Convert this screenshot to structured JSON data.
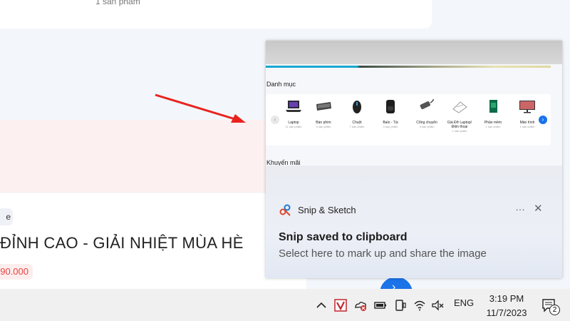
{
  "background_page": {
    "top_card_text": "1 sản phẩm",
    "tag_text": "e",
    "promo_title": "ĐỈNH CAO - GIẢI NHIỆT MÙA HÈ",
    "price": "90.000"
  },
  "snip_preview": {
    "category_heading": "Danh mục",
    "categories": [
      {
        "name": "Laptop",
        "count": "11 sản phẩm",
        "icon": "laptop-icon"
      },
      {
        "name": "Bàn phím",
        "count": "4 sản phẩm",
        "icon": "keyboard-icon"
      },
      {
        "name": "Chuột",
        "count": "7 sản phẩm",
        "icon": "mouse-icon"
      },
      {
        "name": "Balo - Túi",
        "count": "3 sản phẩm",
        "icon": "backpack-icon"
      },
      {
        "name": "Cổng chuyển",
        "count": "3 sản phẩm",
        "icon": "usb-hub-icon"
      },
      {
        "name": "Giá Đỡ Laptop/Điện thoại",
        "count": "1 sản phẩm",
        "icon": "stand-icon"
      },
      {
        "name": "Phần mềm",
        "count": "1 sản phẩm",
        "icon": "software-icon"
      },
      {
        "name": "Màn hình",
        "count": "1 sản phẩm",
        "icon": "monitor-icon"
      }
    ],
    "promo_heading": "Khuyến mãi"
  },
  "toast": {
    "app_name": "Snip & Sketch",
    "title": "Snip saved to clipboard",
    "body": "Select here to mark up and share the image",
    "more_icon": "…",
    "close_icon": "✕"
  },
  "taskbar": {
    "language": "ENG",
    "time": "3:19 PM",
    "date": "11/7/2023",
    "notification_count": "2"
  },
  "colors": {
    "arrow": "#e8231f",
    "accent_blue": "#1a73e8",
    "price_red": "#e8423f"
  }
}
